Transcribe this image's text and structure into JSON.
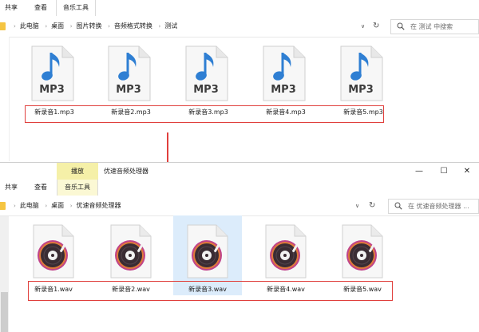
{
  "window1": {
    "ribbon_tabs": [
      "共享",
      "查看",
      "音乐工具"
    ],
    "breadcrumb": [
      "此电脑",
      "桌面",
      "图片转换",
      "音频格式转换",
      "测试"
    ],
    "search_placeholder": "在 测试 中搜索",
    "files": [
      {
        "name": "新录音1.mp3",
        "type_label": "MP3"
      },
      {
        "name": "新录音2.mp3",
        "type_label": "MP3"
      },
      {
        "name": "新录音3.mp3",
        "type_label": "MP3"
      },
      {
        "name": "新录音4.mp3",
        "type_label": "MP3"
      },
      {
        "name": "新录音5.mp3",
        "type_label": "MP3"
      }
    ]
  },
  "window2": {
    "context_tab": "播放",
    "title": "优速音频处理器",
    "ribbon_tabs": [
      "共享",
      "查看",
      "音乐工具"
    ],
    "breadcrumb": [
      "此电脑",
      "桌面",
      "优速音频处理器"
    ],
    "search_placeholder": "在 优速音频处理器 ...",
    "window_controls": {
      "minimize": "—",
      "maximize": "☐",
      "close": "✕"
    },
    "files": [
      {
        "name": "新录音1.wav"
      },
      {
        "name": "新录音2.wav"
      },
      {
        "name": "新录音3.wav"
      },
      {
        "name": "新录音4.wav"
      },
      {
        "name": "新录音5.wav"
      }
    ]
  },
  "colors": {
    "highlight_box": "#e0403d",
    "mp3_note": "#2f7fd3",
    "selection": "#dcecfb",
    "context_tab": "#f5f0a8"
  },
  "icons": {
    "mp3": "music-note-icon",
    "wav": "vinyl-disc-icon",
    "arrow": "down-arrow-icon",
    "search": "search-icon",
    "refresh": "refresh-icon"
  }
}
